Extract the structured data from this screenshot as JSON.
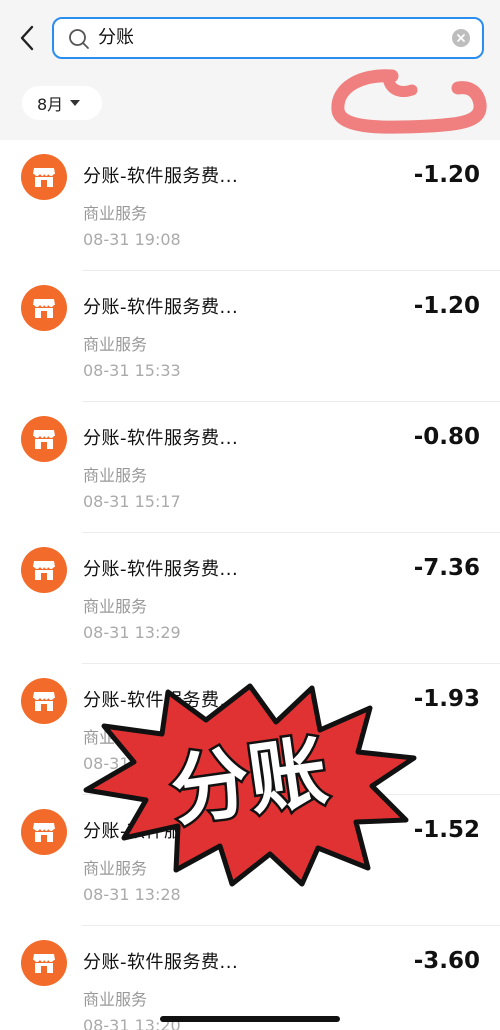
{
  "search": {
    "query": "分账"
  },
  "filter": {
    "month": "8月"
  },
  "transactions": [
    {
      "title": "分账-软件服务费...",
      "category": "商业服务",
      "time": "08-31 19:08",
      "amount": "-1.20"
    },
    {
      "title": "分账-软件服务费...",
      "category": "商业服务",
      "time": "08-31 15:33",
      "amount": "-1.20"
    },
    {
      "title": "分账-软件服务费...",
      "category": "商业服务",
      "time": "08-31 15:17",
      "amount": "-0.80"
    },
    {
      "title": "分账-软件服务费...",
      "category": "商业服务",
      "time": "08-31 13:29",
      "amount": "-7.36"
    },
    {
      "title": "分账-软件服务费...",
      "category": "商业服务",
      "time": "08-31 13:28",
      "amount": "-1.93"
    },
    {
      "title": "分账-软件服务费...",
      "category": "商业服务",
      "time": "08-31 13:28",
      "amount": "-1.52"
    },
    {
      "title": "分账-软件服务费...",
      "category": "商业服务",
      "time": "08-31 13:20",
      "amount": "-3.60"
    }
  ],
  "sticker": {
    "text": "分账"
  },
  "colors": {
    "accent": "#2a8ef0",
    "merchant_icon": "#f26b2a",
    "sticker_fill": "#e03232",
    "scribble": "#f08080"
  }
}
